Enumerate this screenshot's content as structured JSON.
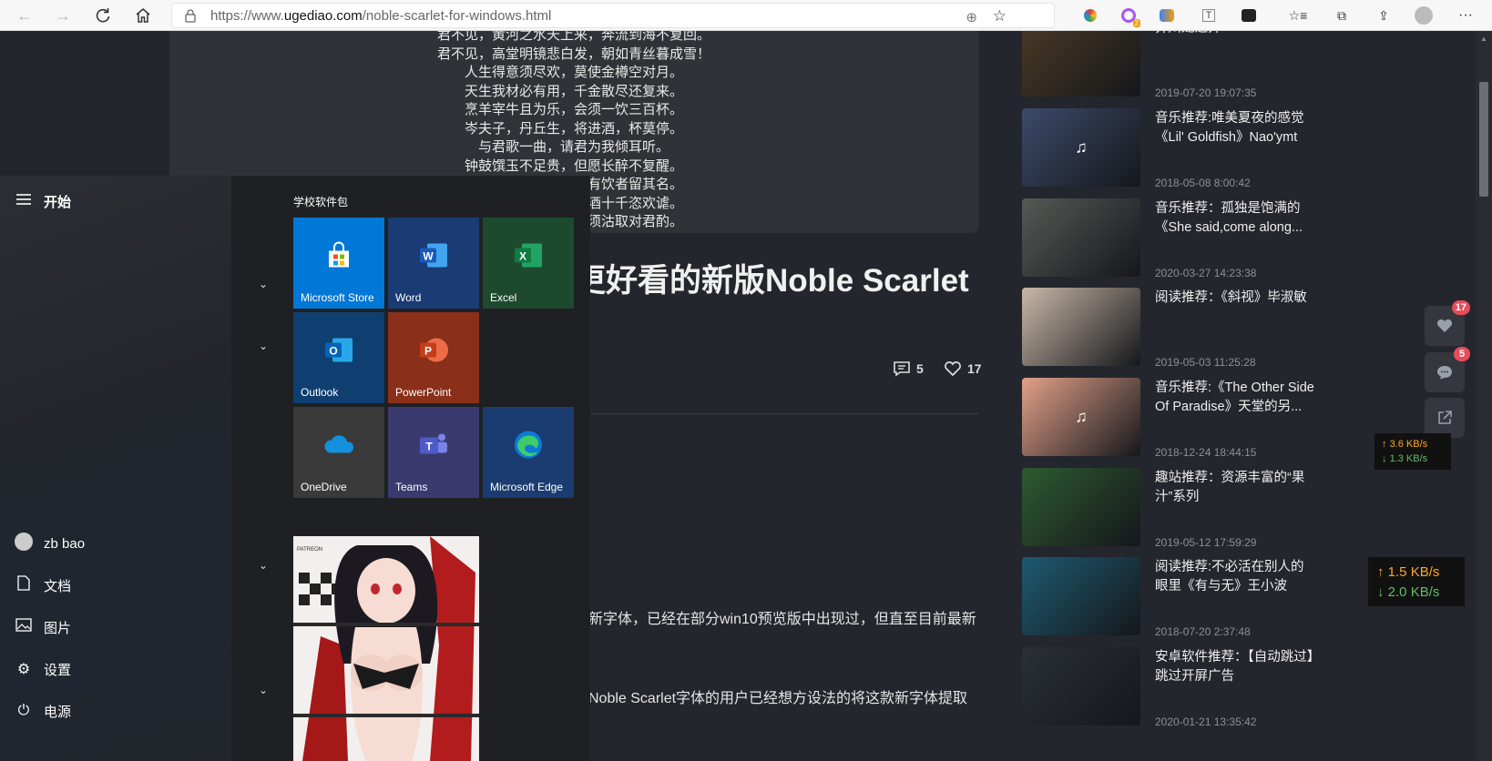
{
  "browser": {
    "url_scheme": "https://www.",
    "url_host": "ugediao.com",
    "url_path": "/noble-scarlet-for-windows.html"
  },
  "page": {
    "poem_lines": [
      "君不见，黄河之水天上来，奔流到海不复回。",
      "君不见，高堂明镜悲白发，朝如青丝暮成雪！",
      "人生得意须尽欢，莫使金樽空对月。",
      "天生我材必有用，千金散尽还复来。",
      "烹羊宰牛且为乐，会须一饮三百杯。",
      "岑夫子，丹丘生，将进酒，杯莫停。",
      "与君歌一曲，请君为我倾耳听。",
      "钟鼓馔玉不足贵，但愿长醉不复醒。",
      "古来圣贤皆寂寞，惟有饮者留其名。",
      "陈王昔时宴平乐，斗酒十千恣欢谑。",
      "主人何为言少钱，径须沽取对君酌。"
    ],
    "title_fragment": "更好看的新版Noble Scarlet",
    "comments_count": "5",
    "likes_count": "17",
    "para1": "新字体，已经在部分win10预览版中出现过，但直至目前最新",
    "para2": "Noble Scarlet字体的用户已经想方设法的将这款新字体提取"
  },
  "sidebar": {
    "items": [
      {
        "title": "芥川龙之介",
        "date": "2019-07-20 19:07:35",
        "thumb_color": "#4a3a25"
      },
      {
        "title": "音乐推荐:唯美夏夜的感觉《Lil' Goldfish》Nao'ymt",
        "date": "2018-05-08 8:00:42",
        "thumb_color": "#3c4a6a"
      },
      {
        "title": "音乐推荐：孤独是饱满的《She said,come along...",
        "date": "2020-03-27 14:23:38",
        "thumb_color": "#555a55"
      },
      {
        "title": "阅读推荐：《斜视》毕淑敏",
        "date": "2019-05-03 11:25:28",
        "thumb_color": "#c9b8a8"
      },
      {
        "title": "音乐推荐:《The Other Side Of Paradise》天堂的另...",
        "date": "2018-12-24 18:44:15",
        "thumb_color": "#e3a08a"
      },
      {
        "title": "趣站推荐：资源丰富的“果汁”系列",
        "date": "2019-05-12 17:59:29",
        "thumb_color": "#2d5a30"
      },
      {
        "title": "阅读推荐:不必活在别人的眼里《有与无》王小波",
        "date": "2018-07-20 2:37:48",
        "thumb_color": "#1e5a70"
      },
      {
        "title": "安卓软件推荐：【自动跳过】跳过开屏广告",
        "date": "2020-01-21 13:35:42",
        "thumb_color": "#2a3035"
      }
    ]
  },
  "float": {
    "likes_badge": "17",
    "comments_badge": "5"
  },
  "network": {
    "small_up": "3.6 KB/s",
    "small_down": "1.3 KB/s",
    "big_up": "1.5 KB/s",
    "big_down": "2.0 KB/s",
    "up_color": "#ffa726",
    "down_color": "#66bb6a"
  },
  "startmenu": {
    "header": "开始",
    "user": "zb bao",
    "documents": "文档",
    "pictures": "图片",
    "settings": "设置",
    "power": "电源",
    "group_title": "学校软件包",
    "tiles": [
      {
        "label": "Microsoft Store",
        "color": "#0078d7",
        "icon": "store-icon"
      },
      {
        "label": "Word",
        "color": "#1a3b73",
        "icon": "word-icon"
      },
      {
        "label": "Excel",
        "color": "#1d4a2e",
        "icon": "excel-icon"
      },
      {
        "label": "Outlook",
        "color": "#0f3f70",
        "icon": "outlook-icon"
      },
      {
        "label": "PowerPoint",
        "color": "#8a2f1a",
        "icon": "powerpoint-icon"
      },
      {
        "label": "OneDrive",
        "color": "#3a3a3a",
        "icon": "onedrive-icon"
      },
      {
        "label": "Teams",
        "color": "#3b3a6e",
        "icon": "teams-icon"
      },
      {
        "label": "Microsoft Edge",
        "color": "#1a3c70",
        "icon": "edge-icon"
      }
    ],
    "picture_tile_text": "PATREON"
  }
}
